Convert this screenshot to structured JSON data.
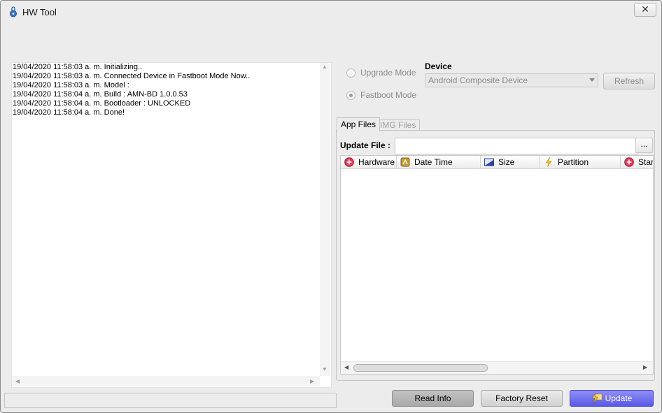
{
  "window": {
    "title": "HW Tool",
    "close_glyph": "✕"
  },
  "log": {
    "lines": [
      "19/04/2020 11:58:03 a. m. Initializing..",
      "19/04/2020 11:58:03 a. m. Connected Device in Fastboot Mode Now..",
      "19/04/2020 11:58:03 a. m. Model :",
      "19/04/2020 11:58:04 a. m. Build : AMN-BD 1.0.0.53",
      "19/04/2020 11:58:04 a. m. Bootloader : UNLOCKED",
      "19/04/2020 11:58:04 a. m. Done!"
    ]
  },
  "mode": {
    "options": [
      {
        "label": "Upgrade Mode",
        "checked": false
      },
      {
        "label": "Fastboot Mode",
        "checked": true
      }
    ]
  },
  "device": {
    "label": "Device",
    "selected": "Android Composite Device",
    "refresh_label": "Refresh"
  },
  "tabs": [
    {
      "label": "App Files",
      "active": true
    },
    {
      "label": "IMG Files",
      "active": false
    }
  ],
  "update_file": {
    "label": "Update File :",
    "value": "",
    "browse_label": "..."
  },
  "grid": {
    "columns": [
      {
        "label": "Hardware",
        "icon": "hardware-icon"
      },
      {
        "label": "Date Time",
        "icon": "date-time-icon"
      },
      {
        "label": "Size",
        "icon": "size-icon"
      },
      {
        "label": "Partition",
        "icon": "partition-icon"
      },
      {
        "label": "Star",
        "icon": "star-icon"
      }
    ],
    "rows": []
  },
  "actions": {
    "read_info": "Read Info",
    "factory_reset": "Factory Reset",
    "update": "Update"
  },
  "colors": {
    "window_bg": "#ececec",
    "update_button": "#6c6cf0",
    "read_info_button": "#b5b5b5"
  }
}
